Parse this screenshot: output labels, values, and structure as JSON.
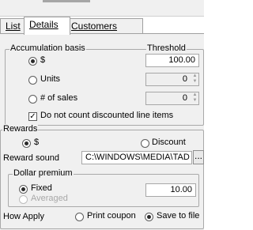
{
  "tabs": [
    {
      "label": "List"
    },
    {
      "label": "Details"
    },
    {
      "label": "Customers"
    }
  ],
  "accumulation": {
    "legend": "Accumulation basis",
    "threshold_label": "Threshold",
    "options": [
      {
        "label": "$",
        "selected": true,
        "value": "100.00"
      },
      {
        "label": "Units",
        "selected": false,
        "value": "0"
      },
      {
        "label": "# of sales",
        "selected": false,
        "value": "0"
      }
    ],
    "discount_checkbox": {
      "label": "Do not count discounted line items",
      "checked": true
    }
  },
  "rewards": {
    "legend": "Rewards",
    "type_options": [
      {
        "label": "$",
        "selected": true
      },
      {
        "label": "Discount",
        "selected": false
      }
    ],
    "sound_label": "Reward sound",
    "sound_value": "C:\\WINDOWS\\MEDIA\\TAD",
    "browse_label": "...",
    "dollar_premium": {
      "legend": "Dollar premium",
      "options": [
        {
          "label": "Fixed",
          "selected": true,
          "enabled": true
        },
        {
          "label": "Averaged",
          "selected": false,
          "enabled": false
        }
      ],
      "value": "10.00"
    },
    "how_apply": {
      "label": "How Apply",
      "options": [
        {
          "label": "Print coupon",
          "selected": false
        },
        {
          "label": "Save to file",
          "selected": true
        }
      ]
    }
  }
}
